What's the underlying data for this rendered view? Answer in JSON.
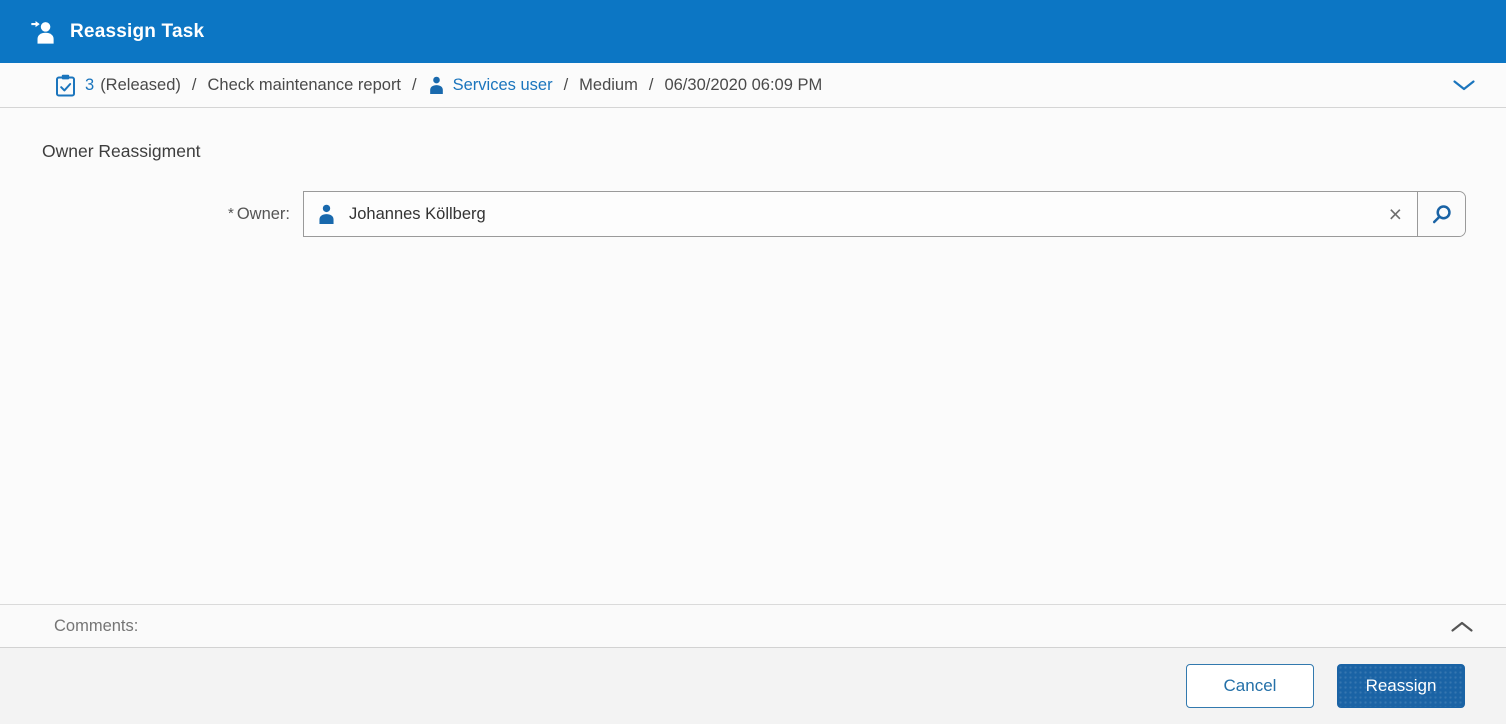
{
  "header": {
    "title": "Reassign Task"
  },
  "breadcrumb": {
    "task_number": "3",
    "task_state": "(Released)",
    "separator": "/",
    "task_name": "Check maintenance report",
    "owner_link": "Services user",
    "priority": "Medium",
    "due_date": "06/30/2020 06:09 PM"
  },
  "form": {
    "section_title": "Owner Reassigment",
    "required_marker": "*",
    "owner_label": "Owner:",
    "owner_value": "Johannes Köllberg",
    "clear_icon": "×"
  },
  "comments": {
    "label": "Comments:"
  },
  "footer": {
    "cancel_label": "Cancel",
    "reassign_label": "Reassign"
  },
  "colors": {
    "header_bg": "#0c76c4",
    "link_blue": "#1b75bd",
    "icon_blue": "#1969ad",
    "primary_button_bg": "#1a63a5",
    "cancel_border": "#3279ae",
    "footer_bg": "#f3f3f3",
    "content_bg": "#fbfbfb",
    "divider": "#d5d5d5",
    "input_border": "#9a9a9a"
  }
}
